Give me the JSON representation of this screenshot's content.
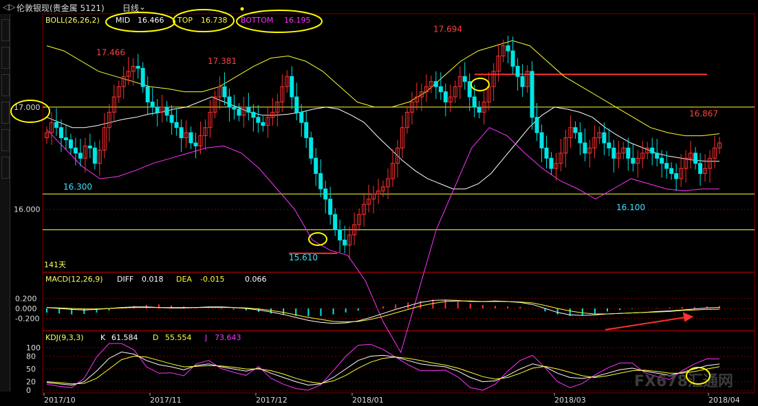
{
  "window": {
    "instrument": "伦敦银现(贵金属 5121)",
    "period": "日线"
  },
  "indicators": {
    "boll": {
      "label": "BOLL(26,26,2)",
      "mid_label": "MID",
      "mid": "16.466",
      "top_label": "TOP",
      "top": "16.738",
      "bottom_label": "BOTTOM",
      "bottom": "16.195"
    },
    "macd": {
      "label": "MACD(12,26,9)",
      "diff_label": "DIFF",
      "diff": "0.018",
      "dea_label": "DEA",
      "dea": "-0.015",
      "macd": "0.066"
    },
    "kdj": {
      "label": "KDJ(9,3,3)",
      "k_label": "K",
      "k": "61.584",
      "d_label": "D",
      "d": "55.554",
      "j_label": "J",
      "j": "73.643"
    }
  },
  "annotations": {
    "days": "141天",
    "watermark": "FX678汇通网"
  },
  "colors": {
    "up": "#ff3030",
    "down": "#00e5e5",
    "boll_mid": "#ffffff",
    "boll_top": "#ffff33",
    "boll_bottom": "#ff33ff",
    "hline": "#ffff33",
    "marker": "#ffff00",
    "grid": "#7a0000"
  },
  "chart_data": [
    {
      "type": "candlestick",
      "title": "伦敦银现 日线",
      "y_ticks": [
        "17.000",
        "16.000"
      ],
      "ylim": [
        15.4,
        17.9
      ],
      "x_ticks": [
        "2017/10",
        "2017/11",
        "2017/12",
        "2018/01",
        "2018/03",
        "2018/04"
      ],
      "price_labels": [
        {
          "text": "17.466",
          "value": 17.466,
          "kind": "high"
        },
        {
          "text": "16.300",
          "value": 16.3,
          "kind": "low"
        },
        {
          "text": "17.381",
          "value": 17.381,
          "kind": "high"
        },
        {
          "text": "15.610",
          "value": 15.61,
          "kind": "low"
        },
        {
          "text": "17.694",
          "value": 17.694,
          "kind": "high"
        },
        {
          "text": "16.100",
          "value": 16.1,
          "kind": "low"
        },
        {
          "text": "16.867",
          "value": 16.867,
          "kind": "high"
        }
      ],
      "horizontal_lines": [
        17.0,
        16.15,
        15.8
      ],
      "close": [
        16.75,
        16.85,
        16.8,
        16.7,
        16.68,
        16.6,
        16.55,
        16.5,
        16.62,
        16.6,
        16.45,
        16.58,
        16.8,
        16.95,
        17.1,
        17.2,
        17.3,
        17.35,
        17.4,
        17.38,
        17.2,
        17.05,
        17.0,
        16.95,
        17.0,
        16.92,
        16.85,
        16.8,
        16.7,
        16.75,
        16.65,
        16.62,
        16.72,
        16.8,
        16.95,
        17.1,
        17.2,
        17.1,
        17.0,
        16.98,
        16.92,
        17.0,
        16.95,
        16.9,
        16.85,
        16.82,
        16.9,
        16.95,
        17.05,
        17.2,
        17.3,
        17.1,
        16.95,
        16.85,
        16.7,
        16.5,
        16.35,
        16.2,
        16.1,
        15.95,
        15.8,
        15.7,
        15.65,
        15.75,
        15.85,
        15.95,
        16.05,
        16.1,
        16.15,
        16.18,
        16.22,
        16.3,
        16.45,
        16.6,
        16.8,
        16.95,
        17.05,
        17.1,
        17.15,
        17.2,
        17.25,
        17.2,
        17.15,
        17.05,
        17.1,
        17.2,
        17.3,
        17.25,
        17.1,
        17.0,
        16.95,
        17.05,
        17.2,
        17.35,
        17.5,
        17.6,
        17.55,
        17.4,
        17.3,
        17.2,
        17.35,
        16.9,
        16.75,
        16.6,
        16.5,
        16.4,
        16.45,
        16.55,
        16.7,
        16.8,
        16.75,
        16.65,
        16.55,
        16.6,
        16.7,
        16.75,
        16.65,
        16.6,
        16.5,
        16.55,
        16.6,
        16.5,
        16.45,
        16.5,
        16.55,
        16.6,
        16.55,
        16.5,
        16.45,
        16.4,
        16.35,
        16.3,
        16.4,
        16.5,
        16.55,
        16.45,
        16.35,
        16.4,
        16.5,
        16.6,
        16.65
      ],
      "boll_mid": [
        16.9,
        16.85,
        16.8,
        16.8,
        16.82,
        16.85,
        16.88,
        16.9,
        16.93,
        16.95,
        16.98,
        17.0,
        17.05,
        17.1,
        17.05,
        17.0,
        16.95,
        16.92,
        16.92,
        16.93,
        16.95,
        16.98,
        17.0,
        16.98,
        16.92,
        16.85,
        16.72,
        16.6,
        16.48,
        16.38,
        16.3,
        16.25,
        16.2,
        16.2,
        16.25,
        16.35,
        16.5,
        16.65,
        16.8,
        16.92,
        17.0,
        16.98,
        16.95,
        16.9,
        16.8,
        16.72,
        16.65,
        16.6,
        16.55,
        16.52,
        16.5,
        16.48,
        16.47,
        16.47
      ],
      "boll_top": [
        17.6,
        17.55,
        17.45,
        17.35,
        17.3,
        17.25,
        17.2,
        17.18,
        17.15,
        17.15,
        17.2,
        17.3,
        17.4,
        17.48,
        17.5,
        17.45,
        17.35,
        17.2,
        17.05,
        17.0,
        17.0,
        17.05,
        17.15,
        17.3,
        17.45,
        17.55,
        17.6,
        17.65,
        17.6,
        17.45,
        17.3,
        17.2,
        17.1,
        17.0,
        16.9,
        16.8,
        16.75,
        16.72,
        16.72,
        16.74
      ],
      "boll_bottom": [
        16.78,
        16.6,
        16.42,
        16.3,
        16.32,
        16.38,
        16.45,
        16.5,
        16.55,
        16.6,
        16.62,
        16.55,
        16.4,
        16.2,
        16.0,
        15.7,
        15.6,
        15.55,
        15.3,
        14.9,
        14.6,
        15.2,
        15.8,
        16.2,
        16.6,
        16.8,
        16.72,
        16.55,
        16.4,
        16.28,
        16.2,
        16.1,
        16.2,
        16.3,
        16.25,
        16.2,
        16.18,
        16.2,
        16.2
      ],
      "range_lines": [
        {
          "value": 17.32
        },
        {
          "value": 15.61
        }
      ]
    },
    {
      "type": "bar",
      "title": "MACD(12,26,9)",
      "y_ticks": [
        "0.200",
        "0.000",
        "-0.200"
      ],
      "ylim": [
        -0.4,
        0.4
      ],
      "diff": [
        0.02,
        0.0,
        -0.02,
        -0.03,
        -0.02,
        0.0,
        0.02,
        0.03,
        0.03,
        0.02,
        0.01,
        0.01,
        0.02,
        0.03,
        0.03,
        0.02,
        0.0,
        -0.03,
        -0.07,
        -0.12,
        -0.18,
        -0.24,
        -0.28,
        -0.3,
        -0.29,
        -0.25,
        -0.18,
        -0.1,
        -0.02,
        0.05,
        0.12,
        0.16,
        0.17,
        0.16,
        0.14,
        0.14,
        0.15,
        0.14,
        0.12,
        0.08,
        0.0,
        -0.08,
        -0.13,
        -0.14,
        -0.13,
        -0.11,
        -0.1,
        -0.09,
        -0.08,
        -0.06,
        -0.05,
        -0.03,
        -0.01,
        0.01,
        0.02
      ],
      "dea": [
        0.02,
        0.01,
        0.0,
        -0.01,
        -0.01,
        0.0,
        0.01,
        0.02,
        0.02,
        0.02,
        0.02,
        0.02,
        0.02,
        0.02,
        0.02,
        0.02,
        0.01,
        -0.01,
        -0.04,
        -0.08,
        -0.13,
        -0.18,
        -0.22,
        -0.26,
        -0.27,
        -0.26,
        -0.22,
        -0.16,
        -0.09,
        -0.02,
        0.05,
        0.1,
        0.14,
        0.15,
        0.15,
        0.14,
        0.14,
        0.14,
        0.13,
        0.11,
        0.06,
        0.0,
        -0.05,
        -0.09,
        -0.11,
        -0.11,
        -0.1,
        -0.09,
        -0.08,
        -0.07,
        -0.06,
        -0.04,
        -0.03,
        -0.02,
        -0.015
      ],
      "hist": [
        -0.08,
        -0.1,
        -0.12,
        -0.11,
        -0.08,
        -0.04,
        0.01,
        0.05,
        0.07,
        0.08,
        0.06,
        0.04,
        0.02,
        0.0,
        -0.01,
        -0.02,
        -0.04,
        -0.07,
        -0.1,
        -0.13,
        -0.15,
        -0.16,
        -0.15,
        -0.12,
        -0.08,
        -0.04,
        0.0,
        0.04,
        0.08,
        0.12,
        0.15,
        0.18,
        0.17,
        0.14,
        0.1,
        0.07,
        0.05,
        0.04,
        0.03,
        0.0,
        -0.06,
        -0.12,
        -0.15,
        -0.14,
        -0.1,
        -0.06,
        -0.03,
        -0.01,
        0.0,
        0.01,
        0.02,
        0.03,
        0.03,
        0.04,
        0.05
      ]
    },
    {
      "type": "line",
      "title": "KDJ(9,3,3)",
      "y_ticks": [
        "100",
        "80",
        "50",
        "20",
        "0"
      ],
      "ylim": [
        0,
        110
      ],
      "k": [
        18,
        15,
        12,
        20,
        45,
        75,
        90,
        85,
        70,
        60,
        55,
        48,
        58,
        62,
        55,
        50,
        45,
        52,
        40,
        30,
        20,
        12,
        15,
        30,
        50,
        70,
        80,
        82,
        78,
        70,
        62,
        58,
        55,
        45,
        30,
        20,
        22,
        35,
        50,
        62,
        55,
        40,
        30,
        28,
        32,
        40,
        48,
        52,
        45,
        40,
        35,
        42,
        50,
        58,
        61.58
      ],
      "d": [
        20,
        18,
        15,
        16,
        28,
        50,
        72,
        80,
        78,
        70,
        62,
        55,
        56,
        58,
        57,
        54,
        50,
        50,
        46,
        38,
        28,
        20,
        16,
        22,
        35,
        52,
        66,
        75,
        78,
        75,
        70,
        64,
        59,
        52,
        42,
        32,
        26,
        30,
        40,
        52,
        56,
        50,
        42,
        34,
        30,
        34,
        40,
        46,
        47,
        44,
        40,
        40,
        44,
        50,
        55.55
      ],
      "j": [
        14,
        9,
        6,
        28,
        78,
        125,
        126,
        95,
        55,
        40,
        41,
        34,
        62,
        70,
        51,
        42,
        35,
        56,
        28,
        14,
        4,
        0,
        13,
        46,
        80,
        106,
        108,
        96,
        78,
        60,
        46,
        46,
        47,
        31,
        6,
        0,
        14,
        45,
        70,
        82,
        53,
        20,
        6,
        16,
        36,
        52,
        64,
        64,
        41,
        32,
        25,
        46,
        62,
        74,
        73.64
      ]
    }
  ]
}
